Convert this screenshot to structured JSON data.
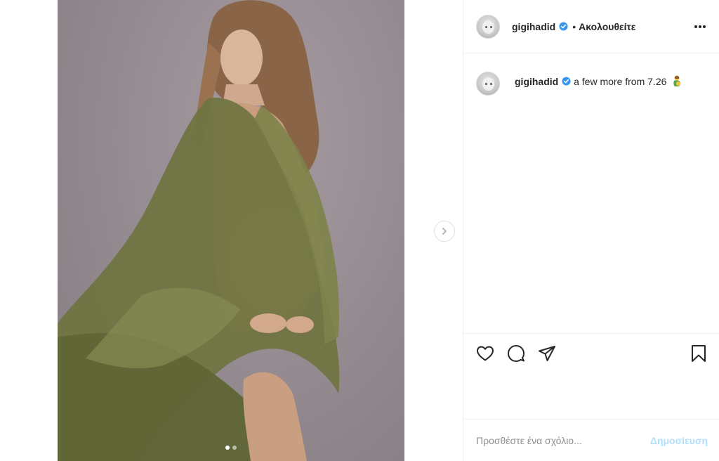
{
  "post": {
    "username": "gigihadid",
    "follow_separator": "•",
    "follow_status": "Ακολουθείτε",
    "caption_username": "gigihadid",
    "caption_text": "a few more from 7.26",
    "carousel": {
      "total": 2,
      "active": 1
    }
  },
  "comment": {
    "placeholder": "Προσθέστε ένα σχόλιο...",
    "post_label": "Δημοσίευση"
  },
  "icons": {
    "verified": "verified-badge-icon",
    "more": "more-options-icon",
    "like": "heart-icon",
    "comment": "comment-icon",
    "share": "paper-plane-icon",
    "save": "bookmark-icon",
    "next": "chevron-right-icon",
    "emoji": "pregnant-woman-emoji"
  },
  "colors": {
    "verified": "#3897f0",
    "post_button": "#b2dffc",
    "border": "#efefef",
    "text": "#262626",
    "muted": "#8e8e8e"
  }
}
